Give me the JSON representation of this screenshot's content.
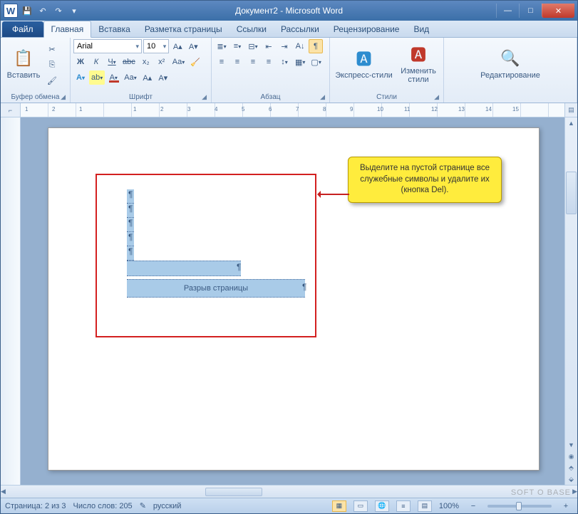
{
  "title": "Документ2 - Microsoft Word",
  "qat": {
    "word": "W",
    "save": "💾",
    "undo": "↶",
    "redo": "↷",
    "more": "▾"
  },
  "tabs": {
    "file": "Файл",
    "list": [
      "Главная",
      "Вставка",
      "Разметка страницы",
      "Ссылки",
      "Рассылки",
      "Рецензирование",
      "Вид"
    ],
    "active": 0
  },
  "ribbon": {
    "clipboard": {
      "label": "Буфер обмена",
      "paste": "Вставить",
      "cut": "✂",
      "copy": "⎘",
      "painter": "🖌"
    },
    "font": {
      "label": "Шрифт",
      "name": "Arial",
      "size": "10",
      "bold": "Ж",
      "italic": "К",
      "underline": "Ч",
      "strike": "abc",
      "sub": "x₂",
      "sup": "x²",
      "case": "Aa",
      "clear": "🧹",
      "grow": "A▴",
      "shrink": "A▾",
      "effects": "A",
      "highlight": "ab",
      "color": "A"
    },
    "para": {
      "label": "Абзац",
      "bullets": "≣",
      "numbers": "≡",
      "multi": "⊟",
      "dind": "⇤",
      "iind": "⇥",
      "sort": "A↓",
      "marks": "¶",
      "al": "≡",
      "ac": "≡",
      "ar": "≡",
      "aj": "≡",
      "ls": "↕",
      "shade": "▦",
      "border": "▢"
    },
    "styles": {
      "label": "Стили",
      "quick": "Экспресс-стили",
      "change": "Изменить стили"
    },
    "editing": {
      "label": "Редактирование",
      "find": "🔍"
    }
  },
  "ruler": {
    "marks": [
      "1",
      "2",
      "1",
      "",
      "1",
      "2",
      "3",
      "4",
      "5",
      "6",
      "7",
      "8",
      "9",
      "10",
      "11",
      "12",
      "13",
      "14",
      "15"
    ]
  },
  "doc": {
    "pagebreak_label": "Разрыв страницы",
    "pilcrow": "¶"
  },
  "callout": "Выделите на пустой странице все служебные символы и удалите их (кнопка Del).",
  "status": {
    "page": "Страница: 2 из 3",
    "words": "Число слов: 205",
    "lang": "русский",
    "zoom": "100%"
  },
  "watermark": "SOFT O BASE"
}
